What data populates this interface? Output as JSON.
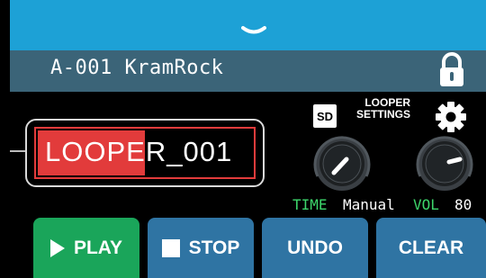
{
  "header": {
    "patch_name": "A-001 KramRock"
  },
  "looper": {
    "name": "LOOPER_001",
    "name_highlight": "LOOPE",
    "name_rest": "R_001",
    "sd_label": "SD",
    "settings_label_line1": "LOOPER",
    "settings_label_line2": "SETTINGS"
  },
  "knobs": {
    "time": {
      "label": "TIME",
      "value": "Manual"
    },
    "vol": {
      "label": "VOL",
      "value": "80"
    }
  },
  "buttons": {
    "play": "PLAY",
    "stop": "STOP",
    "undo": "UNDO",
    "clear": "CLEAR"
  },
  "icons": {
    "collapse": "chevron-down-icon",
    "lock": "lock-icon",
    "settings": "gear-icon",
    "sd": "sd-card-icon"
  },
  "colors": {
    "top_bar": "#1da1d6",
    "header": "#3b6478",
    "highlight_red": "#e23b3b",
    "play_green": "#1aa55a",
    "button_blue": "#2f74a3",
    "label_green": "#3dd66b"
  }
}
